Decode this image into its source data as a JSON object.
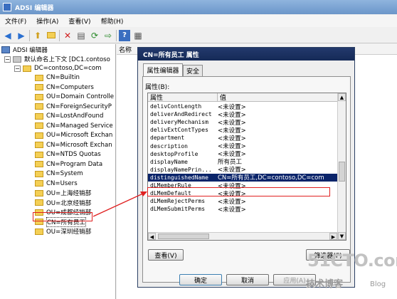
{
  "window": {
    "title": "ADSI 编辑器"
  },
  "menu": [
    "文件(F)",
    "操作(A)",
    "查看(V)",
    "帮助(H)"
  ],
  "toolbar_icons": [
    "back-icon",
    "forward-icon",
    "up-icon",
    "folder-icon",
    "delete-icon",
    "properties-icon",
    "refresh-icon",
    "export-icon",
    "help-icon",
    "view-icon"
  ],
  "tree": {
    "root": "ADSI 编辑器",
    "context": "默认命名上下文 [DC1.contoso",
    "domain": "DC=contoso,DC=com",
    "items": [
      "CN=Builtin",
      "CN=Computers",
      "OU=Domain Controlle",
      "CN=ForeignSecurityP",
      "CN=LostAndFound",
      "CN=Managed Service",
      "OU=Microsoft Exchan",
      "CN=Microsoft Exchan",
      "CN=NTDS Quotas",
      "CN=Program Data",
      "CN=System",
      "CN=Users",
      "OU=上海经销部",
      "OU=北京经销部",
      "OU=成都经销部",
      "CN=所有员工",
      "OU=深圳经销部"
    ],
    "selected_index": 15
  },
  "list": {
    "column": "名称"
  },
  "dialog": {
    "title": "CN=所有员工 属性",
    "tabs": [
      "属性编辑器",
      "安全"
    ],
    "attributes_label": "属性(B):",
    "columns": [
      "属性",
      "值"
    ],
    "rows": [
      {
        "attr": "delivContLength",
        "value": "<未设置>"
      },
      {
        "attr": "deliverAndRedirect",
        "value": "<未设置>"
      },
      {
        "attr": "deliveryMechanism",
        "value": "<未设置>"
      },
      {
        "attr": "delivExtContTypes",
        "value": "<未设置>"
      },
      {
        "attr": "department",
        "value": "<未设置>"
      },
      {
        "attr": "description",
        "value": "<未设置>"
      },
      {
        "attr": "desktopProfile",
        "value": "<未设置>"
      },
      {
        "attr": "displayName",
        "value": "所有员工"
      },
      {
        "attr": "displayNamePrin...",
        "value": "<未设置>"
      },
      {
        "attr": "distinguishedName",
        "value": "CN=所有员工,DC=contoso,DC=com"
      },
      {
        "attr": "dLMemberRule",
        "value": "<未设置>"
      },
      {
        "attr": "dLMemDefault",
        "value": "<未设置>"
      },
      {
        "attr": "dLMemRejectPerms",
        "value": "<未设置>"
      },
      {
        "attr": "dLMemSubmitPerms",
        "value": "<未设置>"
      }
    ],
    "selected_row": 9,
    "view_button": "查看(V)",
    "filter_button": "筛选器(F)",
    "buttons": {
      "ok": "确定",
      "cancel": "取消",
      "apply": "应用(A)"
    }
  },
  "watermark": {
    "main": "51CTO.com",
    "sub": "技术博客",
    "blog": "Blog"
  },
  "colors": {
    "selection": "#0a246a",
    "annotation": "#e02020",
    "title_active": "#152a57"
  }
}
